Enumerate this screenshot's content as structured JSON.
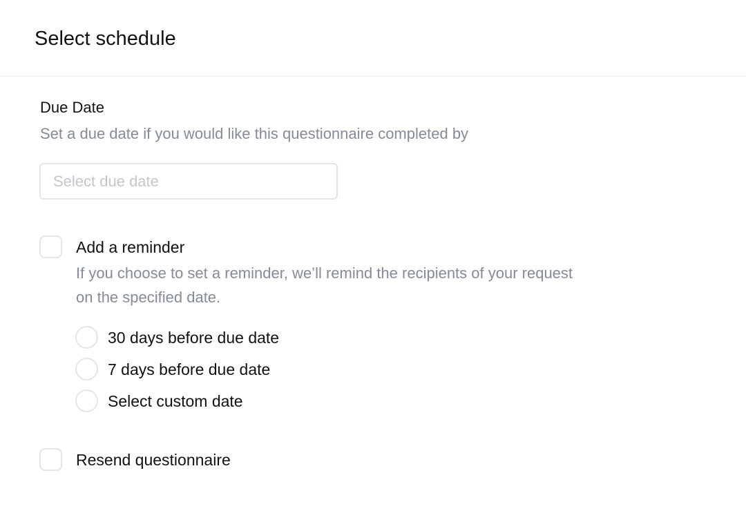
{
  "header": {
    "title": "Select schedule"
  },
  "due_date": {
    "label": "Due Date",
    "description": "Set a due date if you would like this questionnaire completed by",
    "input": {
      "value": "",
      "placeholder": "Select due date"
    }
  },
  "reminder": {
    "checked": false,
    "label": "Add a reminder",
    "description": "If you choose to set a reminder, we’ll remind the recipients of your request on the specified date.",
    "options": [
      {
        "label": "30 days before due date",
        "selected": false
      },
      {
        "label": "7 days before due date",
        "selected": false
      },
      {
        "label": "Select custom date",
        "selected": false
      }
    ]
  },
  "resend": {
    "checked": false,
    "label": "Resend questionnaire"
  },
  "colors": {
    "text_primary": "#111111",
    "text_muted": "#858b96",
    "border": "#e3e5e8",
    "placeholder": "#c3c7cd",
    "divider": "#eceef1"
  }
}
